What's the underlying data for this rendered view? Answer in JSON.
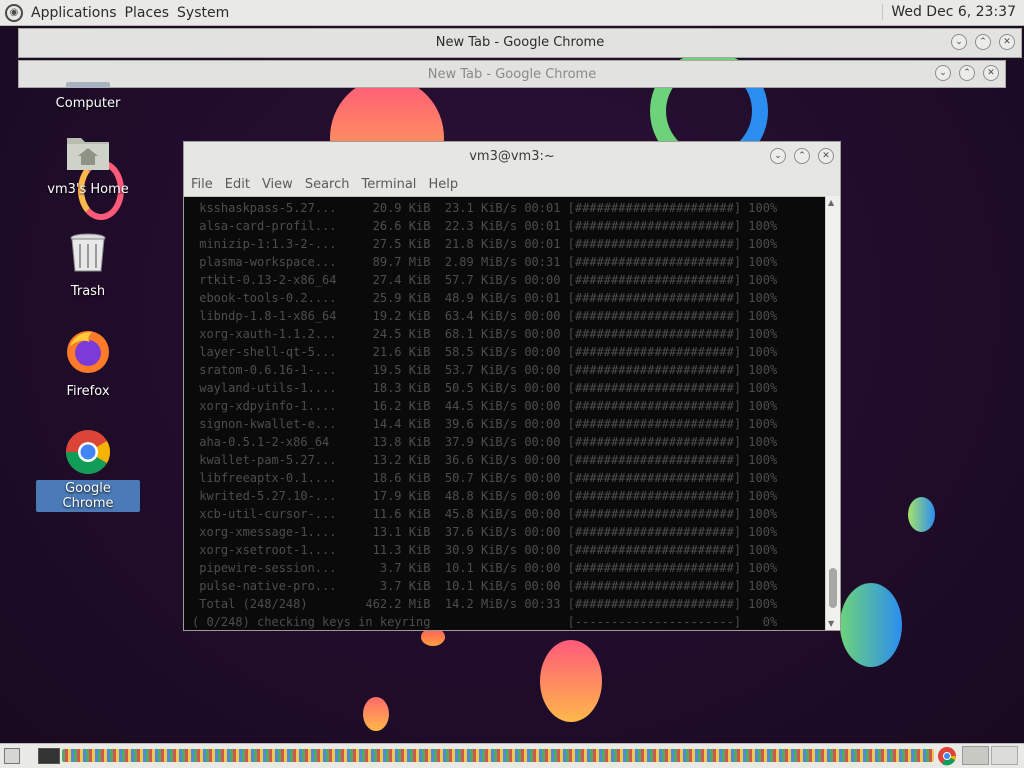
{
  "top_panel": {
    "menus": [
      "Applications",
      "Places",
      "System"
    ],
    "clock": "Wed Dec 6, 23:37"
  },
  "chrome_windows": [
    {
      "title": "New Tab - Google Chrome",
      "active": true
    },
    {
      "title": "New Tab - Google Chrome",
      "active": false
    }
  ],
  "desktop_icons": [
    {
      "label": "Computer",
      "icon": "computer-icon"
    },
    {
      "label": "vm3's Home",
      "icon": "home-folder-icon"
    },
    {
      "label": "Trash",
      "icon": "trash-icon"
    },
    {
      "label": "Firefox",
      "icon": "firefox-icon"
    },
    {
      "label": "Google Chrome",
      "icon": "chrome-icon",
      "selected": true
    }
  ],
  "terminal": {
    "title": "vm3@vm3:~",
    "menus": [
      "File",
      "Edit",
      "View",
      "Search",
      "Terminal",
      "Help"
    ],
    "lines": [
      " ksshaskpass-5.27...     20.9 KiB  23.1 KiB/s 00:01 [######################] 100%",
      " alsa-card-profil...     26.6 KiB  22.3 KiB/s 00:01 [######################] 100%",
      " minizip-1:1.3-2-...     27.5 KiB  21.8 KiB/s 00:01 [######################] 100%",
      " plasma-workspace...     89.7 MiB  2.89 MiB/s 00:31 [######################] 100%",
      " rtkit-0.13-2-x86_64     27.4 KiB  57.7 KiB/s 00:00 [######################] 100%",
      " ebook-tools-0.2....     25.9 KiB  48.9 KiB/s 00:01 [######################] 100%",
      " libndp-1.8-1-x86_64     19.2 KiB  63.4 KiB/s 00:00 [######################] 100%",
      " xorg-xauth-1.1.2...     24.5 KiB  68.1 KiB/s 00:00 [######################] 100%",
      " layer-shell-qt-5...     21.6 KiB  58.5 KiB/s 00:00 [######################] 100%",
      " sratom-0.6.16-1-...     19.5 KiB  53.7 KiB/s 00:00 [######################] 100%",
      " wayland-utils-1....     18.3 KiB  50.5 KiB/s 00:00 [######################] 100%",
      " xorg-xdpyinfo-1....     16.2 KiB  44.5 KiB/s 00:00 [######################] 100%",
      " signon-kwallet-e...     14.4 KiB  39.6 KiB/s 00:00 [######################] 100%",
      " aha-0.5.1-2-x86_64      13.8 KiB  37.9 KiB/s 00:00 [######################] 100%",
      " kwallet-pam-5.27...     13.2 KiB  36.6 KiB/s 00:00 [######################] 100%",
      " libfreeaptx-0.1....     18.6 KiB  50.7 KiB/s 00:00 [######################] 100%",
      " kwrited-5.27.10-...     17.9 KiB  48.8 KiB/s 00:00 [######################] 100%",
      " xcb-util-cursor-...     11.6 KiB  45.8 KiB/s 00:00 [######################] 100%",
      " xorg-xmessage-1....     13.1 KiB  37.6 KiB/s 00:00 [######################] 100%",
      " xorg-xsetroot-1....     11.3 KiB  30.9 KiB/s 00:00 [######################] 100%",
      " pipewire-session...      3.7 KiB  10.1 KiB/s 00:00 [######################] 100%",
      " pulse-native-pro...      3.7 KiB  10.1 KiB/s 00:00 [######################] 100%",
      " Total (248/248)        462.2 MiB  14.2 MiB/s 00:33 [######################] 100%",
      "( 0/248) checking keys in keyring                   [----------------------]   0%"
    ]
  },
  "colors": {
    "panel_bg": "#e9e9e6",
    "terminal_bg": "#0a0a0a",
    "terminal_text": "#4d4d4d",
    "selected_label": "#4a7bb8"
  }
}
